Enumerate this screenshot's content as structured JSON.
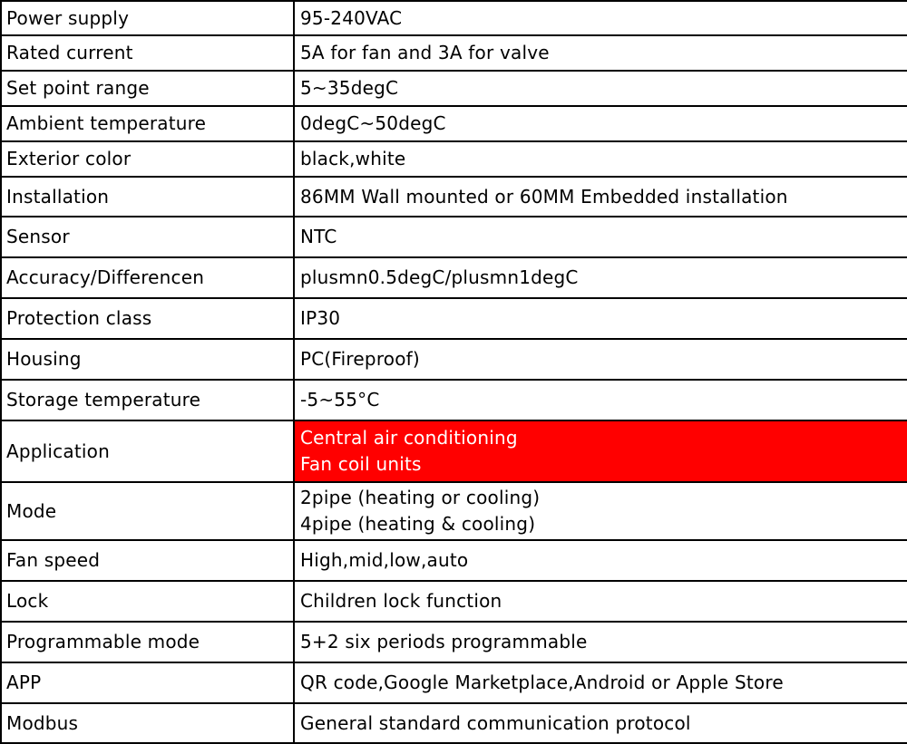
{
  "colors": {
    "highlight_bg": "#ff0000",
    "highlight_text": "#ffffff",
    "border": "#000000"
  },
  "rows": [
    {
      "label": "Power supply",
      "value": [
        "95-240VAC"
      ]
    },
    {
      "label": "Rated current",
      "value": [
        "5A for fan and 3A for valve"
      ]
    },
    {
      "label": "Set point range",
      "value": [
        "5~35degC"
      ]
    },
    {
      "label": "Ambient temperature",
      "value": [
        "0degC~50degC"
      ]
    },
    {
      "label": "Exterior color",
      "value": [
        "black,white"
      ]
    },
    {
      "label": "Installation",
      "value": [
        "86MM Wall mounted or 60MM Embedded installation"
      ]
    },
    {
      "label": "Sensor",
      "value": [
        "NTC"
      ]
    },
    {
      "label": "Accuracy/Differencen",
      "value": [
        "plusmn0.5degC/plusmn1degC"
      ]
    },
    {
      "label": "Protection class",
      "value": [
        "IP30"
      ]
    },
    {
      "label": "Housing",
      "value": [
        "PC(Fireproof)"
      ]
    },
    {
      "label": "Storage temperature",
      "value": [
        "-5~55°C"
      ]
    },
    {
      "label": "Application",
      "value": [
        "Central air conditioning",
        "Fan coil units"
      ],
      "highlight": true
    },
    {
      "label": "Mode",
      "value": [
        "2pipe (heating or cooling)",
        "4pipe (heating & cooling)"
      ]
    },
    {
      "label": "Fan speed",
      "value": [
        "High,mid,low,auto"
      ]
    },
    {
      "label": "Lock",
      "value": [
        "Children  lock function"
      ]
    },
    {
      "label": "Programmable mode",
      "value": [
        "5+2 six periods programmable"
      ]
    },
    {
      "label": "APP",
      "value": [
        "QR  code,Google Marketplace,Android or Apple Store"
      ]
    },
    {
      "label": "Modbus",
      "value": [
        "General standard communication protocol"
      ]
    }
  ]
}
